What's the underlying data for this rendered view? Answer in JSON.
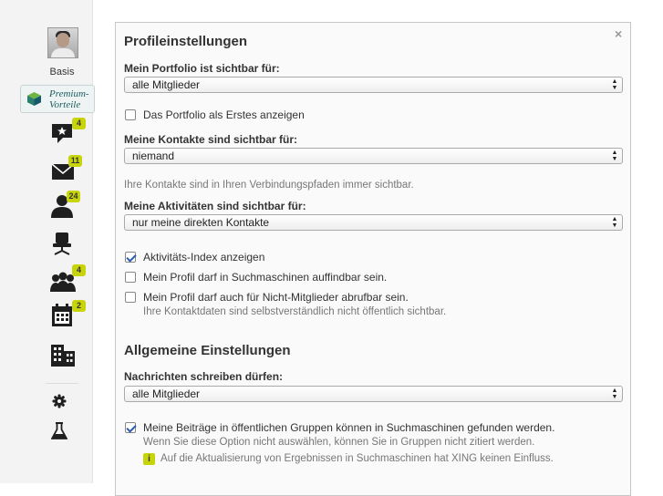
{
  "sidebar": {
    "profile_label": "Basis",
    "premium_line1": "Premium-",
    "premium_line2": "Vorteile",
    "badges": {
      "activity": "4",
      "messages": "11",
      "contacts": "24",
      "groups": "4",
      "events": "2"
    },
    "colors": {
      "badge": "#c8d40a",
      "icon": "#1f1f1f",
      "premium_text": "#1d5c5e"
    }
  },
  "panel": {
    "close_glyph": "×",
    "profile_heading": "Profileinstellungen",
    "portfolio_label": "Mein Portfolio ist sichtbar für:",
    "portfolio_value": "alle Mitglieder",
    "portfolio_first": "Das Portfolio als Erstes anzeigen",
    "contacts_label": "Meine Kontakte sind sichtbar für:",
    "contacts_value": "niemand",
    "contacts_hint": "Ihre Kontakte sind in Ihren Verbindungspfaden immer sichtbar.",
    "activities_label": "Meine Aktivitäten sind sichtbar für:",
    "activities_value": "nur meine direkten Kontakte",
    "activity_index": "Aktivitäts-Index anzeigen",
    "search_engines": "Mein Profil darf in Suchmaschinen auffindbar sein.",
    "non_members": "Mein Profil darf auch für Nicht-Mitglieder abrufbar sein.",
    "non_members_hint": "Ihre Kontaktdaten sind selbstverständlich nicht öffentlich sichtbar.",
    "general_heading": "Allgemeine Einstellungen",
    "messages_label": "Nachrichten schreiben dürfen:",
    "messages_value": "alle Mitglieder",
    "group_posts": "Meine Beiträge in öffentlichen Gruppen können in Suchmaschinen gefunden werden.",
    "group_posts_hint": "Wenn Sie diese Option nicht auswählen, können Sie in Gruppen nicht zitiert werden.",
    "info_text": "Auf die Aktualisierung von Ergebnissen in Suchmaschinen hat XING keinen Einfluss.",
    "info_glyph": "i"
  },
  "checkboxes": {
    "portfolio_first": false,
    "activity_index": true,
    "search_engines": false,
    "non_members": false,
    "group_posts": true
  }
}
